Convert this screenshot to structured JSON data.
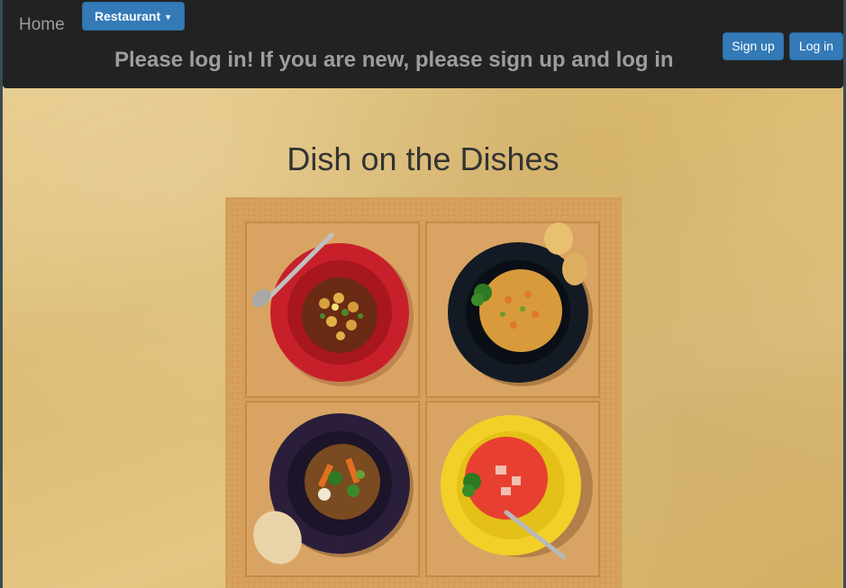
{
  "navbar": {
    "home_label": "Home",
    "restaurant_label": "Restaurant",
    "message": "Please log in! If you are new, please sign up and log in",
    "signup_label": "Sign up",
    "login_label": "Log in"
  },
  "main": {
    "title": "Dish on the Dishes"
  },
  "colors": {
    "navbar_bg": "#222222",
    "button_primary": "#337ab7",
    "nav_text": "#9d9d9d"
  }
}
